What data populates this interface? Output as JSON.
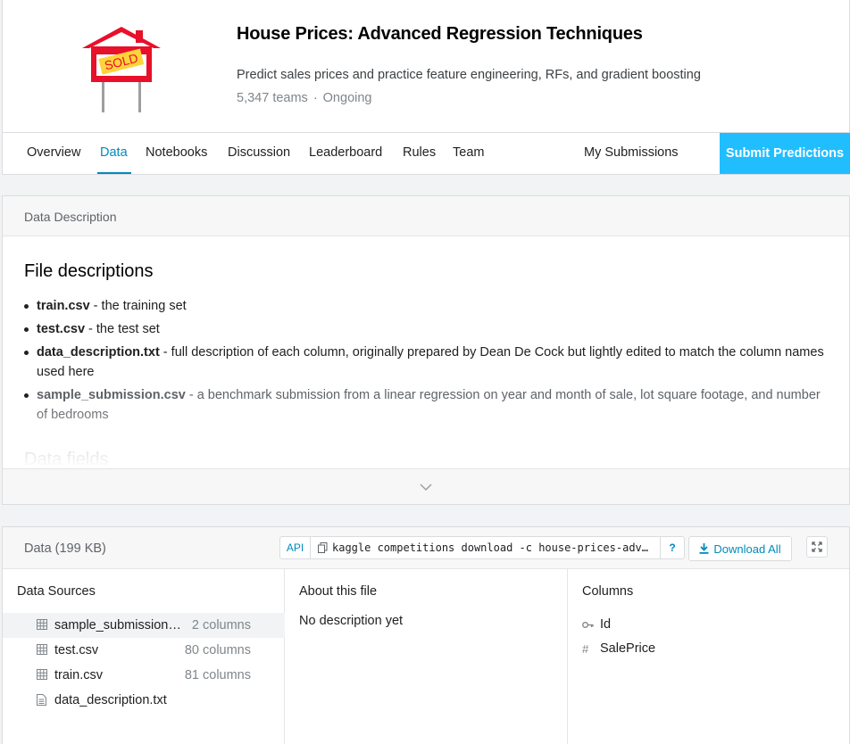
{
  "competition": {
    "title": "House Prices: Advanced Regression Techniques",
    "subtitle": "Predict sales prices and practice feature engineering, RFs, and gradient boosting",
    "teams": "5,347 teams",
    "separator": "·",
    "status": "Ongoing",
    "logo_text": "SOLD"
  },
  "tabs": [
    {
      "label": "Overview",
      "active": false
    },
    {
      "label": "Data",
      "active": true
    },
    {
      "label": "Notebooks",
      "active": false
    },
    {
      "label": "Discussion",
      "active": false
    },
    {
      "label": "Leaderboard",
      "active": false
    },
    {
      "label": "Rules",
      "active": false
    },
    {
      "label": "Team",
      "active": false
    }
  ],
  "my_submissions": "My Submissions",
  "submit_predictions": "Submit Predictions",
  "description": {
    "header": "Data Description",
    "heading": "File descriptions",
    "files": [
      {
        "name": "train.csv",
        "text": " - the training set"
      },
      {
        "name": "test.csv",
        "text": " - the test set"
      },
      {
        "name": "data_description.txt",
        "text": " - full description of each column, originally prepared by Dean De Cock but lightly edited to match the column names used here"
      },
      {
        "name": "sample_submission.csv",
        "text": " - a benchmark submission from a linear regression on year and month of sale, lot square footage, and number of bedrooms"
      }
    ],
    "next_heading": "Data fields"
  },
  "data": {
    "header": "Data (199 KB)",
    "api_label": "API",
    "api_command": "kaggle competitions download -c house-prices-adv…",
    "api_help": "?",
    "download_all": "Download All",
    "sources_title": "Data Sources",
    "sources": [
      {
        "name": "sample_submission…",
        "count": "2 columns",
        "icon": "table-icon",
        "selected": true
      },
      {
        "name": "test.csv",
        "count": "80 columns",
        "icon": "table-icon",
        "selected": false
      },
      {
        "name": "train.csv",
        "count": "81 columns",
        "icon": "table-icon",
        "selected": false
      },
      {
        "name": "data_description.txt",
        "count": "",
        "icon": "file-icon",
        "selected": false
      }
    ],
    "about_title": "About this file",
    "about_text": "No description yet",
    "columns_title": "Columns",
    "columns": [
      {
        "name": "Id",
        "icon": "key-icon"
      },
      {
        "name": "SalePrice",
        "icon": "hash-icon"
      }
    ]
  },
  "colors": {
    "accent": "#008abc",
    "submit_bg": "#20beff",
    "sign_red": "#e8102a",
    "sold_yellow": "#ffd43b"
  }
}
